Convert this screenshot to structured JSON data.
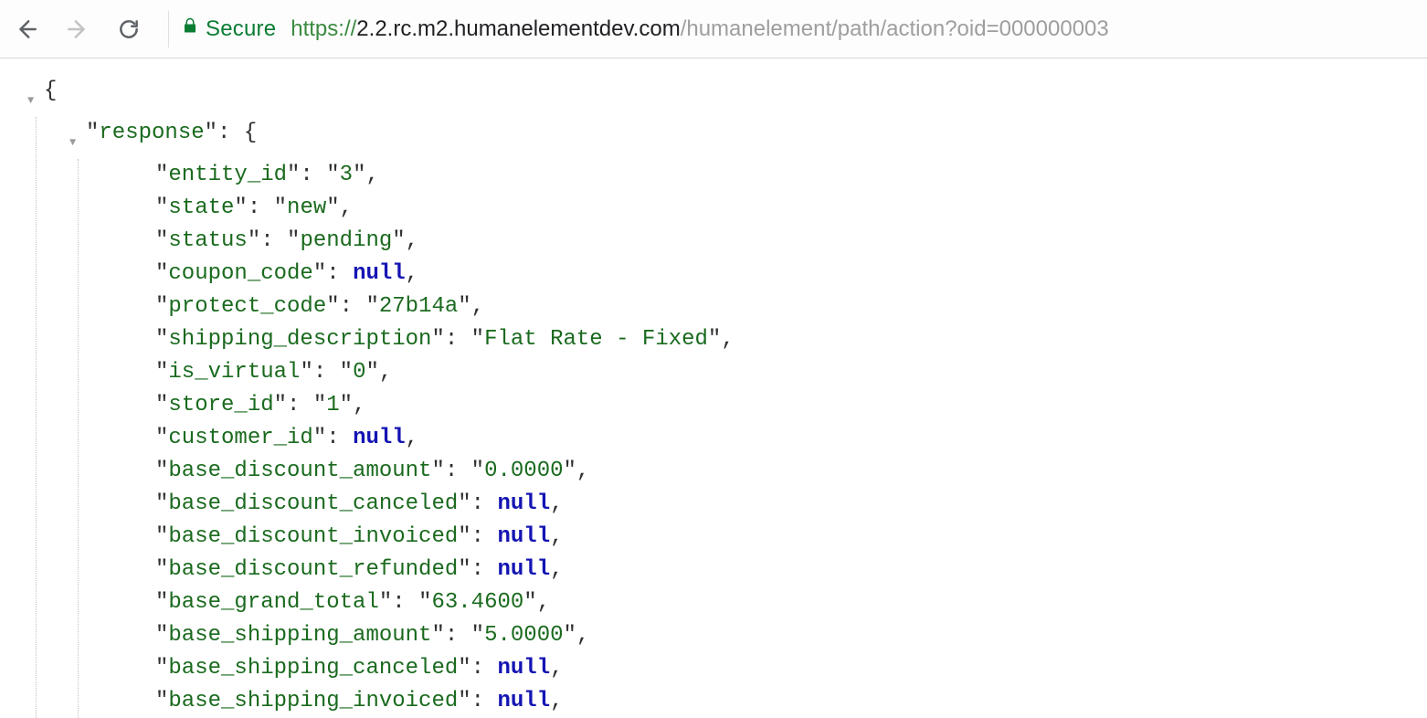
{
  "chrome": {
    "secure_label": "Secure",
    "url_scheme": "https://",
    "url_host": "2.2.rc.m2.humanelementdev.com",
    "url_path": "/humanelement/path/action?oid=000000003"
  },
  "json": {
    "root_brace": "{",
    "response_key": "response",
    "fields": [
      {
        "key": "entity_id",
        "type": "string",
        "value": "3"
      },
      {
        "key": "state",
        "type": "string",
        "value": "new"
      },
      {
        "key": "status",
        "type": "string",
        "value": "pending"
      },
      {
        "key": "coupon_code",
        "type": "null",
        "value": "null"
      },
      {
        "key": "protect_code",
        "type": "string",
        "value": "27b14a"
      },
      {
        "key": "shipping_description",
        "type": "string",
        "value": "Flat Rate - Fixed"
      },
      {
        "key": "is_virtual",
        "type": "string",
        "value": "0"
      },
      {
        "key": "store_id",
        "type": "string",
        "value": "1"
      },
      {
        "key": "customer_id",
        "type": "null",
        "value": "null"
      },
      {
        "key": "base_discount_amount",
        "type": "string",
        "value": "0.0000"
      },
      {
        "key": "base_discount_canceled",
        "type": "null",
        "value": "null"
      },
      {
        "key": "base_discount_invoiced",
        "type": "null",
        "value": "null"
      },
      {
        "key": "base_discount_refunded",
        "type": "null",
        "value": "null"
      },
      {
        "key": "base_grand_total",
        "type": "string",
        "value": "63.4600"
      },
      {
        "key": "base_shipping_amount",
        "type": "string",
        "value": "5.0000"
      },
      {
        "key": "base_shipping_canceled",
        "type": "null",
        "value": "null"
      },
      {
        "key": "base_shipping_invoiced",
        "type": "null",
        "value": "null"
      }
    ]
  }
}
